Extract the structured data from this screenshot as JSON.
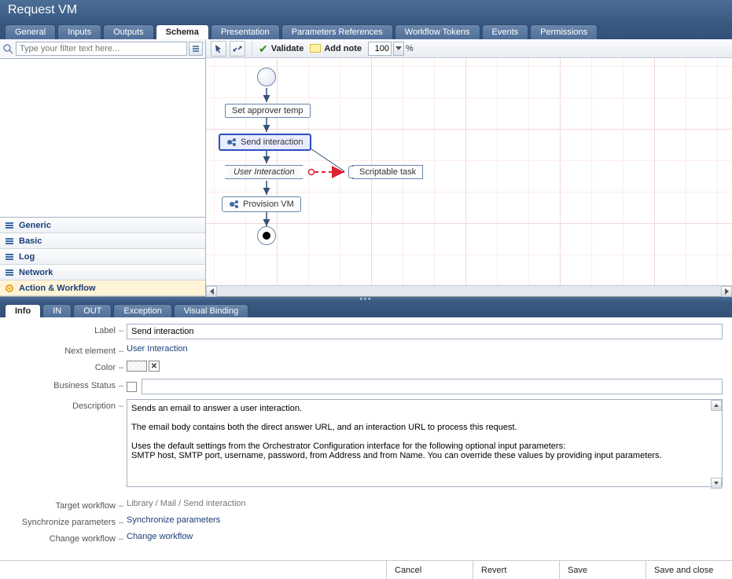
{
  "title": "Request VM",
  "topTabs": [
    "General",
    "Inputs",
    "Outputs",
    "Schema",
    "Presentation",
    "Parameters References",
    "Workflow Tokens",
    "Events",
    "Permissions"
  ],
  "topTabActive": "Schema",
  "filter": {
    "placeholder": "Type your filter text here..."
  },
  "palette": [
    {
      "label": "Generic",
      "selected": false
    },
    {
      "label": "Basic",
      "selected": false
    },
    {
      "label": "Log",
      "selected": false
    },
    {
      "label": "Network",
      "selected": false
    },
    {
      "label": "Action & Workflow",
      "selected": true
    }
  ],
  "toolbar": {
    "validate": "Validate",
    "addnote": "Add note",
    "zoom": "100",
    "zoomUnit": "%"
  },
  "workflow": {
    "setApprover": "Set approver temp",
    "sendInteraction": "Send interaction",
    "userInteraction": "User Interaction",
    "provisionVm": "Provision VM",
    "scriptable": "Scriptable task"
  },
  "bottomTabs": [
    "Info",
    "IN",
    "OUT",
    "Exception",
    "Visual Binding"
  ],
  "bottomTabActive": "Info",
  "form": {
    "labelLabel": "Label",
    "labelValue": "Send interaction",
    "nextElementLabel": "Next element",
    "nextElementValue": "User Interaction",
    "colorLabel": "Color",
    "businessStatusLabel": "Business Status",
    "businessStatusValue": "",
    "descriptionLabel": "Description",
    "descriptionValue": "Sends an email to answer a user interaction.\n\nThe email body contains both the direct answer URL, and an interaction URL to process this request.\n\nUses the default settings from the Orchestrator Configuration interface for the following optional input parameters:\nSMTP host, SMTP port, username, password, from Address and from Name. You can override these values by providing input parameters.",
    "targetWorkflowLabel": "Target workflow",
    "targetWorkflowValue": "Library / Mail / Send interaction",
    "syncLabel": "Synchronize parameters",
    "syncLink": "Synchronize parameters",
    "changeLabel": "Change workflow",
    "changeLink": "Change workflow"
  },
  "footer": {
    "cancel": "Cancel",
    "revert": "Revert",
    "save": "Save",
    "saveClose": "Save and close"
  }
}
